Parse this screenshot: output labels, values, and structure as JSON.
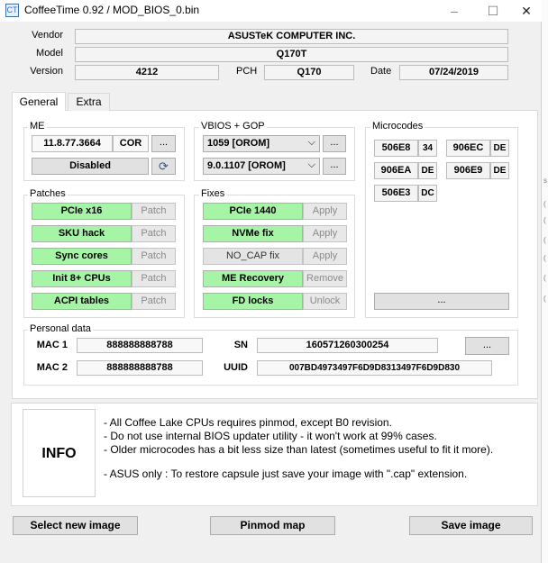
{
  "window": {
    "title": "CoffeeTime 0.92  /  MOD_BIOS_0.bin",
    "app_icon": "CT",
    "minimize_icon": "–",
    "maximize_icon": "☐",
    "close_icon": "✕"
  },
  "info": {
    "vendor_label": "Vendor",
    "vendor_value": "ASUSTeK COMPUTER INC.",
    "model_label": "Model",
    "model_value": "Q170T",
    "version_label": "Version",
    "version_value": "4212",
    "pch_label": "PCH",
    "pch_value": "Q170",
    "date_label": "Date",
    "date_value": "07/24/2019"
  },
  "tabs": [
    "General",
    "Extra"
  ],
  "me": {
    "title": "ME",
    "version": "11.8.77.3664",
    "type": "COR",
    "more_label": "...",
    "status": "Disabled",
    "refresh_icon": "⟳"
  },
  "vbios": {
    "title": "VBIOS + GOP",
    "vbios_value": "1059 [OROM]",
    "gop_value": "9.0.1107 [OROM]",
    "more_label": "...",
    "dropdown_icon": "⌵"
  },
  "microcodes": {
    "title": "Microcodes",
    "items": [
      {
        "id": "506E8",
        "tag": "34"
      },
      {
        "id": "906EC",
        "tag": "DE"
      },
      {
        "id": "906EA",
        "tag": "DE"
      },
      {
        "id": "906E9",
        "tag": "DE"
      },
      {
        "id": "506E3",
        "tag": "DC"
      }
    ],
    "more_label": "..."
  },
  "patches": {
    "title": "Patches",
    "items": [
      {
        "label": "PCIe x16",
        "action": "Patch"
      },
      {
        "label": "SKU hack",
        "action": "Patch"
      },
      {
        "label": "Sync cores",
        "action": "Patch"
      },
      {
        "label": "Init 8+ CPUs",
        "action": "Patch"
      },
      {
        "label": "ACPI tables",
        "action": "Patch"
      }
    ]
  },
  "fixes": {
    "title": "Fixes",
    "items": [
      {
        "label": "PCIe 1440",
        "action": "Apply"
      },
      {
        "label": "NVMe fix",
        "action": "Apply"
      },
      {
        "label": "NO_CAP fix",
        "action": "Apply"
      },
      {
        "label": "ME Recovery",
        "action": "Remove"
      },
      {
        "label": "FD locks",
        "action": "Unlock"
      }
    ]
  },
  "personal": {
    "title": "Personal data",
    "mac1_label": "MAC 1",
    "mac1_value": "888888888788",
    "mac2_label": "MAC 2",
    "mac2_value": "888888888788",
    "sn_label": "SN",
    "sn_value": "160571260300254",
    "uuid_label": "UUID",
    "uuid_value": "007BD4973497F6D9D8313497F6D9D830",
    "more_label": "..."
  },
  "info_panel": {
    "label": "INFO",
    "lines": [
      "- All Coffee Lake CPUs requires pinmod, except B0 revision.",
      "- Do not use internal BIOS updater utility - it won't work at 99% cases.",
      "- Older microcodes has a bit less size than latest (sometimes useful to fit it more).",
      "- ASUS only : To restore capsule just save your image with \".cap\" extension."
    ]
  },
  "bottom": {
    "select_label": "Select new image",
    "pinmod_label": "Pinmod map",
    "save_label": "Save image"
  },
  "background_glyphs": [
    "s",
    "(",
    "(",
    "(",
    "(",
    "(",
    "("
  ]
}
